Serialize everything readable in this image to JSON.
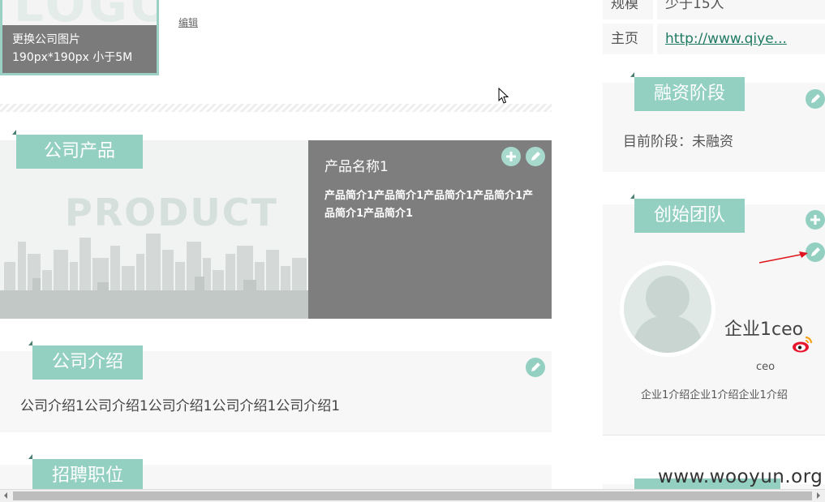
{
  "company": {
    "logo_text": "LOGO",
    "change_image": "更换公司图片",
    "image_spec": "190px*190px 小于5M",
    "edit_label": "编辑"
  },
  "products": {
    "section_title": "公司产品",
    "banner_text": "PRODUCT",
    "items": [
      {
        "name": "产品名称1",
        "description": "产品简介1产品简介1产品简介1产品简介1产品简介1产品简介1"
      }
    ]
  },
  "introduction": {
    "section_title": "公司介绍",
    "text": "公司介绍1公司介绍1公司介绍1公司介绍1公司介绍1"
  },
  "jobs": {
    "section_title": "招聘职位"
  },
  "sidebar": {
    "info_rows": [
      {
        "key": "规模",
        "value": "少于15人"
      },
      {
        "key": "主页",
        "value": "http://www.qiye..."
      }
    ],
    "funding": {
      "section_title": "融资阶段",
      "text": "目前阶段：未融资"
    },
    "team": {
      "section_title": "创始团队",
      "member": {
        "name": "企业1ceo",
        "title": "ceo",
        "intro": "企业1介绍企业1介绍企业1介绍"
      }
    }
  },
  "watermark": "www.wooyun.org",
  "colors": {
    "accent": "#93d0c1",
    "card_gray": "#7e7e7e",
    "annotation_red": "#e0141e"
  },
  "icons": [
    "plus-icon",
    "pencil-icon",
    "weibo-icon",
    "mouse-cursor-icon",
    "red-arrow-annotation"
  ]
}
